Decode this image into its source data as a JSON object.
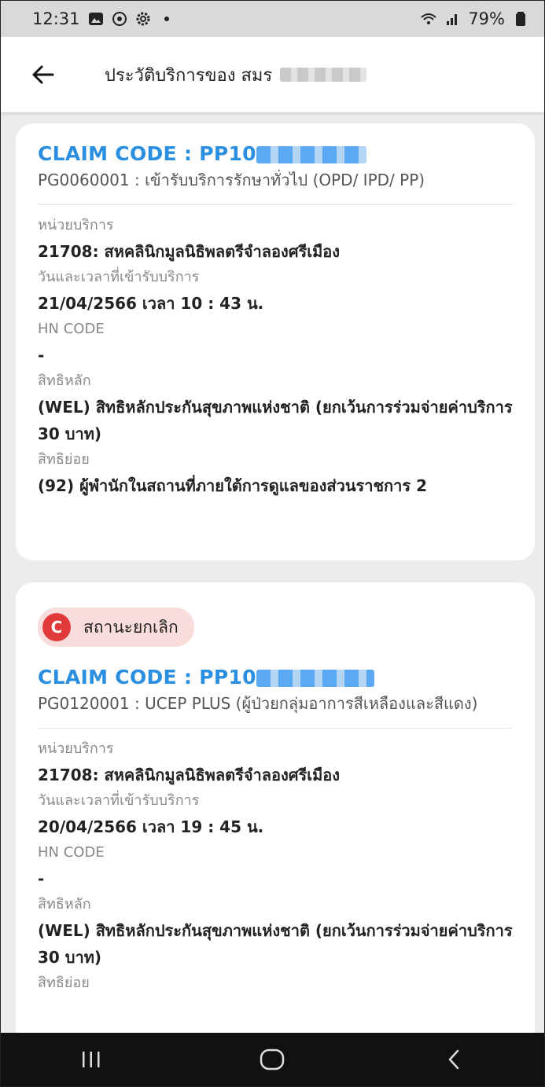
{
  "status": {
    "time": "12:31",
    "battery": "79%",
    "icons": [
      "gallery-icon",
      "focus-icon",
      "settings-icon",
      "dot-icon",
      "wifi-icon",
      "signal-icon",
      "battery-icon"
    ]
  },
  "header": {
    "title": "ประวัติบริการของ สมร",
    "back_icon": "back-arrow-icon"
  },
  "records": [
    {
      "claim_label": "CLAIM CODE :  PP10",
      "description": "PG0060001 : เข้ารับบริการรักษาทั่วไป (OPD/ IPD/ PP)",
      "unit_label": "หน่วยบริการ",
      "unit_value": "21708: สหคลินิกมูลนิธิพลตรีจำลองศรีเมือง",
      "datetime_label": "วันและเวลาที่เข้ารับบริการ",
      "datetime_value": "21/04/2566 เวลา 10 : 43 น.",
      "hn_label": "HN CODE",
      "hn_value": "-",
      "main_right_label": "สิทธิหลัก",
      "main_right_value": "(WEL) สิทธิหลักประกันสุขภาพแห่งชาติ (ยกเว้นการร่วมจ่ายค่าบริการ 30 บาท)",
      "sub_right_label": "สิทธิย่อย",
      "sub_right_value": "(92) ผู้พำนักในสถานที่ภายใต้การดูแลของส่วนราชการ 2"
    },
    {
      "status_badge_letter": "C",
      "status_badge_text": "สถานะยกเลิก",
      "claim_label": "CLAIM CODE :  PP10",
      "description": "PG0120001 : UCEP PLUS (ผู้ป่วยกลุ่มอาการสีเหลืองและสีแดง)",
      "unit_label": "หน่วยบริการ",
      "unit_value": "21708: สหคลินิกมูลนิธิพลตรีจำลองศรีเมือง",
      "datetime_label": "วันและเวลาที่เข้ารับบริการ",
      "datetime_value": "20/04/2566 เวลา 19 : 45 น.",
      "hn_label": "HN CODE",
      "hn_value": "-",
      "main_right_label": "สิทธิหลัก",
      "main_right_value": "(WEL) สิทธิหลักประกันสุขภาพแห่งชาติ (ยกเว้นการร่วมจ่ายค่าบริการ 30 บาท)",
      "sub_right_label": "สิทธิย่อย"
    }
  ],
  "nav": {
    "icons": [
      "recents-icon",
      "home-icon",
      "back-icon"
    ]
  },
  "colors": {
    "accent": "#2a8fe0",
    "badge_bg": "#f9dcdc",
    "badge_icon": "#e03a3a",
    "page_bg": "#ececec"
  }
}
